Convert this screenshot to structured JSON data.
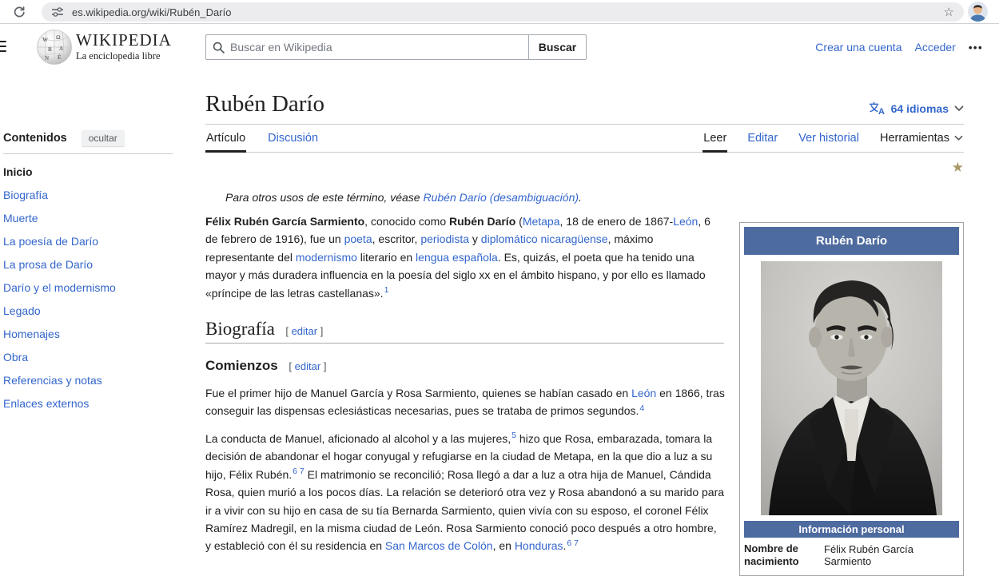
{
  "colors": {
    "accent_link": "#3366cc",
    "infobox_header": "#4e6b9f",
    "featured_star": "#a89968"
  },
  "icons": {
    "bookmark_star": "☆",
    "featured_star": "★",
    "more_menu": "•••"
  },
  "browser": {
    "url": "es.wikipedia.org/wiki/Rubén_Darío"
  },
  "header": {
    "logo_title": "WIKIPEDIA",
    "logo_subtitle": "La enciclopedia libre",
    "search_placeholder": "Buscar en Wikipedia",
    "search_button": "Buscar",
    "create_account": "Crear una cuenta",
    "login": "Acceder"
  },
  "sidebar": {
    "title": "Contenidos",
    "hide_button": "ocultar",
    "items": [
      {
        "label": "Inicio"
      },
      {
        "label": "Biografía"
      },
      {
        "label": "Muerte"
      },
      {
        "label": "La poesía de Darío"
      },
      {
        "label": "La prosa de Darío"
      },
      {
        "label": "Darío y el modernismo"
      },
      {
        "label": "Legado"
      },
      {
        "label": "Homenajes"
      },
      {
        "label": "Obra"
      },
      {
        "label": "Referencias y notas"
      },
      {
        "label": "Enlaces externos"
      }
    ]
  },
  "article": {
    "title": "Rubén Darío",
    "languages_label": "64 idiomas",
    "tabs_left": [
      {
        "label": "Artículo"
      },
      {
        "label": "Discusión"
      }
    ],
    "tabs_right": [
      {
        "label": "Leer"
      },
      {
        "label": "Editar"
      },
      {
        "label": "Ver historial"
      },
      {
        "label": "Herramientas"
      }
    ],
    "edit_open": "[",
    "edit_label": "editar",
    "edit_close": "]",
    "hatnote": [
      {
        "t": "Para otros usos de este término, véase "
      },
      {
        "t": "Rubén Darío (desambiguación)",
        "link": true
      },
      {
        "t": "."
      }
    ],
    "lead_paragraph": [
      {
        "t": "Félix Rubén García Sarmiento",
        "b": true
      },
      {
        "t": ", conocido como "
      },
      {
        "t": "Rubén Darío",
        "b": true
      },
      {
        "t": " ("
      },
      {
        "t": "Metapa",
        "link": true
      },
      {
        "t": ", 18 de enero de 1867-"
      },
      {
        "t": "León",
        "link": true
      },
      {
        "t": ", 6 de febrero de 1916), fue un "
      },
      {
        "t": "poeta",
        "link": true
      },
      {
        "t": ", escritor, "
      },
      {
        "t": "periodista",
        "link": true
      },
      {
        "t": " y "
      },
      {
        "t": "diplomático",
        "link": true
      },
      {
        "t": " "
      },
      {
        "t": "nicaragüense",
        "link": true
      },
      {
        "t": ", máximo representante del "
      },
      {
        "t": "modernismo",
        "link": true
      },
      {
        "t": " literario en "
      },
      {
        "t": "lengua española",
        "link": true
      },
      {
        "t": ". Es, quizás, el poeta que ha tenido una mayor y más duradera influencia en la poesía del siglo xx en el ámbito hispano, y por ello es llamado «príncipe de las letras castellanas»."
      },
      {
        "t": "1",
        "sup": true
      }
    ],
    "heading_biografia": "Biografía",
    "heading_comienzos": "Comienzos",
    "comienzos_p1": [
      {
        "t": "Fue el primer hijo de Manuel García y Rosa Sarmiento, quienes se habían casado en "
      },
      {
        "t": "León",
        "link": true
      },
      {
        "t": " en 1866, tras conseguir las dispensas eclesiásticas necesarias, pues se trataba de primos segundos."
      },
      {
        "t": "4",
        "sup": true
      }
    ],
    "comienzos_p2": [
      {
        "t": "La conducta de Manuel, aficionado al alcohol y a las mujeres,"
      },
      {
        "t": "5",
        "sup": true
      },
      {
        "t": "  hizo que Rosa, embarazada, tomara la decisión de abandonar el hogar conyugal y refugiarse en la ciudad de Metapa, en la que dio a luz a su hijo, Félix Rubén."
      },
      {
        "t": "6 7",
        "sup": true
      },
      {
        "t": "  El matrimonio se reconcilió; Rosa llegó a dar a luz a otra hija de Manuel, Cándida Rosa, quien murió a los pocos días. La relación se deterioró otra vez y Rosa abandonó a su marido para ir a vivir con su hijo en casa de su tía Bernarda Sarmiento, quien vivía con su esposo, el coronel Félix Ramírez Madregil, en la misma ciudad de León. Rosa Sarmiento conoció poco después a otro hombre, y estableció con él su residencia en "
      },
      {
        "t": "San Marcos de Colón",
        "link": true
      },
      {
        "t": ", en "
      },
      {
        "t": "Honduras",
        "link": true
      },
      {
        "t": "."
      },
      {
        "t": "6 7",
        "sup": true
      }
    ]
  },
  "infobox": {
    "title": "Rubén Darío",
    "section": "Información personal",
    "rows": [
      {
        "label": "Nombre de nacimiento",
        "value": "Félix Rubén García Sarmiento"
      }
    ]
  }
}
